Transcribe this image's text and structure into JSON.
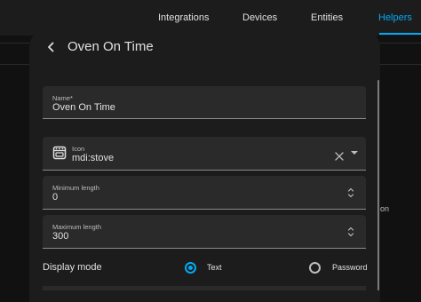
{
  "nav": {
    "tabs": [
      {
        "label": "Integrations"
      },
      {
        "label": "Devices"
      },
      {
        "label": "Entities"
      },
      {
        "label": "Helpers"
      }
    ],
    "active_tab": "Helpers",
    "accent_color": "#03a9f4"
  },
  "background": {
    "peek_text": "on"
  },
  "dialog": {
    "title": "Oven On Time",
    "back_icon": "arrow-left-icon",
    "fields": {
      "name": {
        "label": "Name*",
        "value": "Oven On Time"
      },
      "icon": {
        "label": "Icon",
        "value": "mdi:stove",
        "icon_name": "stove-icon"
      },
      "min_length": {
        "label": "Minimum length",
        "value": "0"
      },
      "max_length": {
        "label": "Maximum length",
        "value": "300"
      }
    },
    "display_mode": {
      "label": "Display mode",
      "options": [
        {
          "label": "Text",
          "selected": true
        },
        {
          "label": "Password",
          "selected": false
        }
      ]
    }
  }
}
